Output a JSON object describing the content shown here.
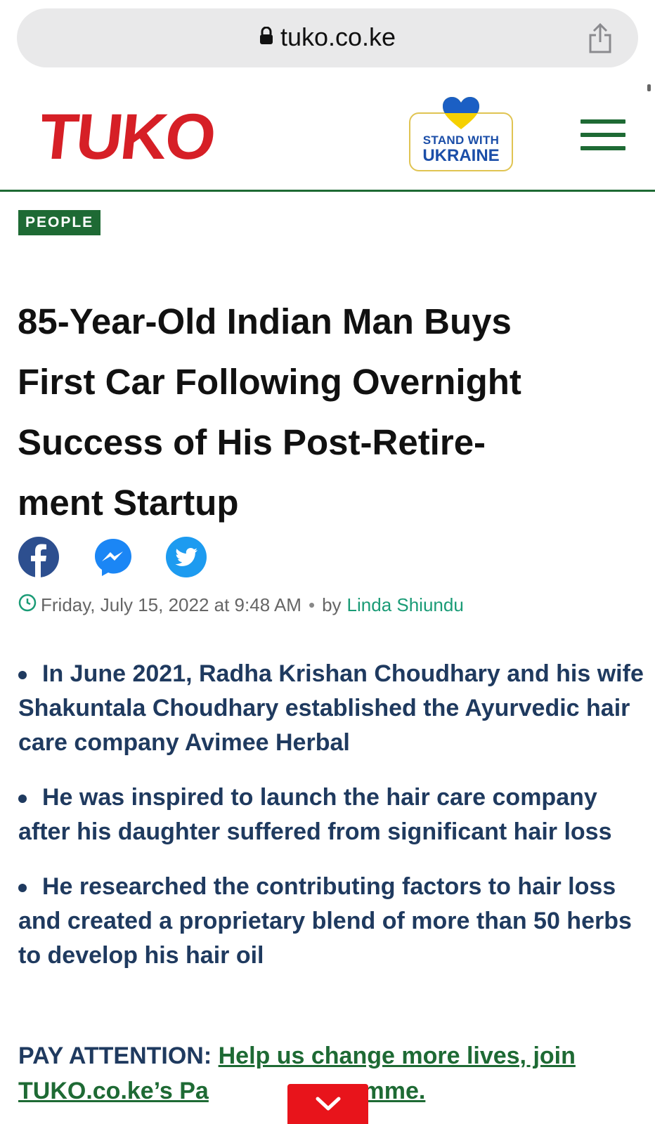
{
  "browser": {
    "url": "tuko.co.ke",
    "lock_icon": "lock-icon",
    "share_icon": "share-icon"
  },
  "header": {
    "logo_text": "TUKO",
    "ukraine_badge": {
      "line1": "STAND WITH",
      "line2": "UKRAINE"
    },
    "menu_icon": "hamburger-menu-icon",
    "colors": {
      "brand_red": "#d61f26",
      "brand_green": "#1e6a34",
      "ukraine_blue": "#1b4ea8",
      "ukraine_yellow": "#f5d000"
    }
  },
  "article": {
    "category": "PEOPLE",
    "headline_lines": [
      "85-Year-Old Indian Man Buys",
      "First Car Following Overnight",
      "Success of His Post-Retire-",
      "ment Startup"
    ],
    "share_icons": [
      "facebook-icon",
      "messenger-icon",
      "twitter-icon"
    ],
    "date": "Friday, July 15, 2022 at 9:48 AM",
    "separator": "•",
    "by_label": "by",
    "author": "Linda Shiundu",
    "bullets": [
      "In June 2021, Radha Krishan Choudhary and his wife Shakuntala Choudhary established the Ayurvedic hair care company Avimee Herbal",
      "He was inspired to launch the hair care company after his daughter suffered from significant hair loss",
      "He researched the contributing factors to hair loss and created a proprietary blend of more than 50 herbs to develop his hair oil"
    ],
    "pay_attention": {
      "label": "PAY ATTENTION:",
      "link_text": "Help us change more lives, join TUKO.co.ke’s Pa",
      "link_tail": "programme."
    }
  },
  "floating": {
    "expand_icon": "chevron-down-icon"
  }
}
